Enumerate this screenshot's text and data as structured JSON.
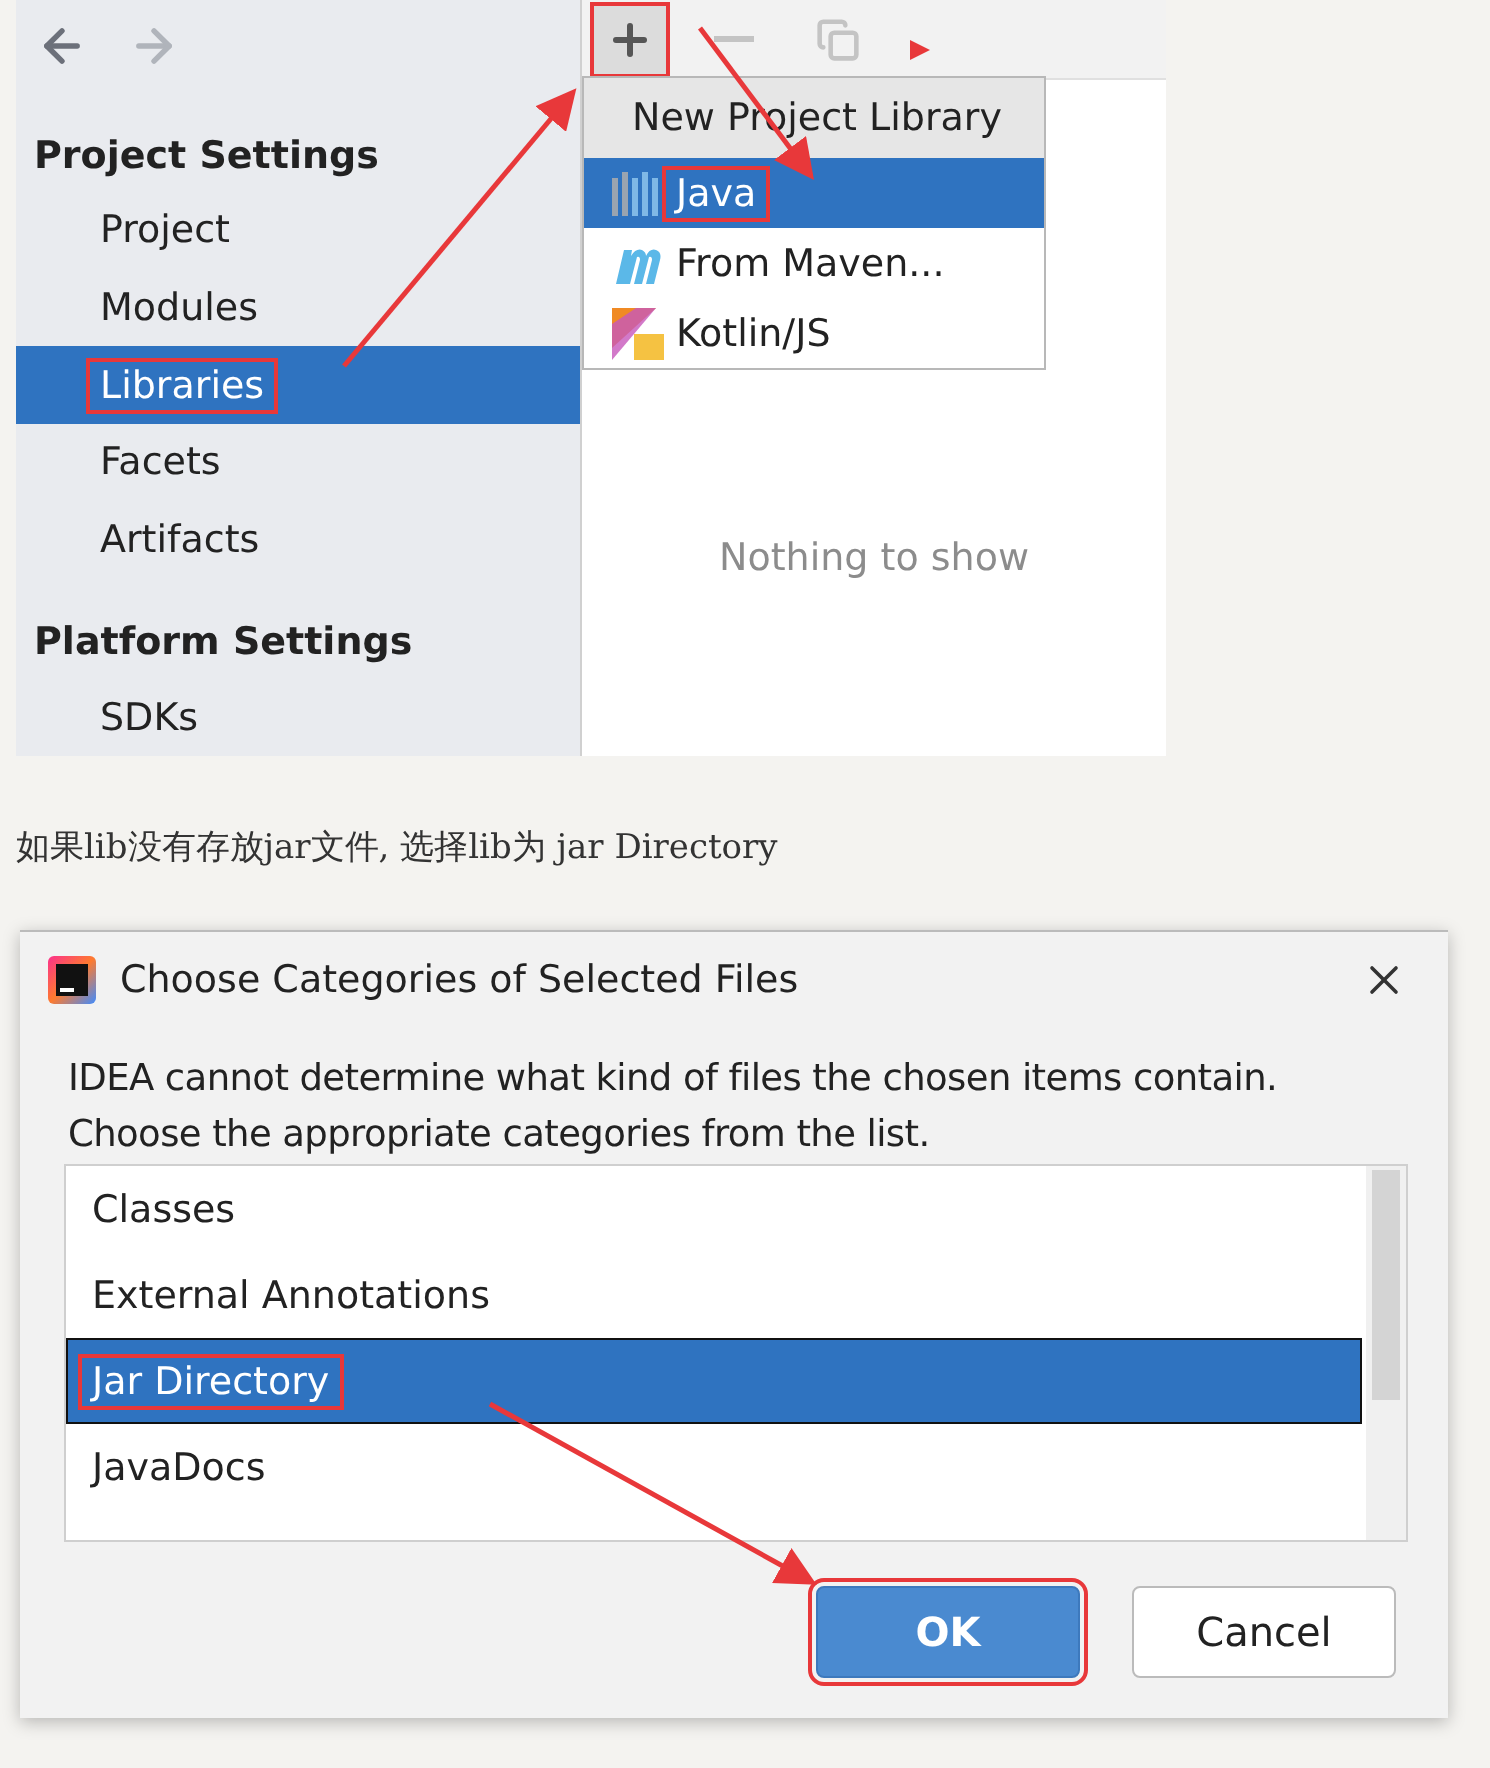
{
  "ide": {
    "sidebar": [
      {
        "title": "Project Settings",
        "items": [
          {
            "label": "Project",
            "selected": false,
            "annotated": false
          },
          {
            "label": "Modules",
            "selected": false,
            "annotated": false
          },
          {
            "label": "Libraries",
            "selected": true,
            "annotated": true
          },
          {
            "label": "Facets",
            "selected": false,
            "annotated": false
          },
          {
            "label": "Artifacts",
            "selected": false,
            "annotated": false
          }
        ]
      },
      {
        "title": "Platform Settings",
        "items": [
          {
            "label": "SDKs",
            "selected": false,
            "annotated": false
          }
        ]
      }
    ],
    "toolbar": [
      {
        "kind": "add",
        "disabled": false,
        "annotated": true
      },
      {
        "kind": "remove",
        "disabled": true,
        "annotated": false
      },
      {
        "kind": "copy",
        "disabled": true,
        "annotated": false
      }
    ],
    "popup": {
      "title": "New Project Library",
      "items": [
        {
          "kind": "java",
          "label": "Java",
          "selected": true,
          "annotated": true
        },
        {
          "kind": "maven",
          "label": "From Maven...",
          "selected": false,
          "annotated": false
        },
        {
          "kind": "kotlin-js",
          "label": "Kotlin/JS",
          "selected": false,
          "annotated": false
        }
      ]
    },
    "empty_text": "Nothing to show"
  },
  "paragraph": "如果lib没有存放jar文件, 选择lib为 jar Directory",
  "dialog": {
    "title": "Choose Categories of Selected Files",
    "message": [
      "IDEA cannot determine what kind of files the chosen items contain.",
      "Choose the appropriate categories from the list."
    ],
    "items": [
      {
        "label": "Classes",
        "selected": false,
        "annotated": false
      },
      {
        "label": "External Annotations",
        "selected": false,
        "annotated": false
      },
      {
        "label": "Jar Directory",
        "selected": true,
        "annotated": true
      },
      {
        "label": "JavaDocs",
        "selected": false,
        "annotated": false
      }
    ],
    "buttons": [
      {
        "kind": "primary",
        "label": "OK",
        "annotated": true
      },
      {
        "kind": "secondary",
        "label": "Cancel",
        "annotated": false
      }
    ]
  }
}
